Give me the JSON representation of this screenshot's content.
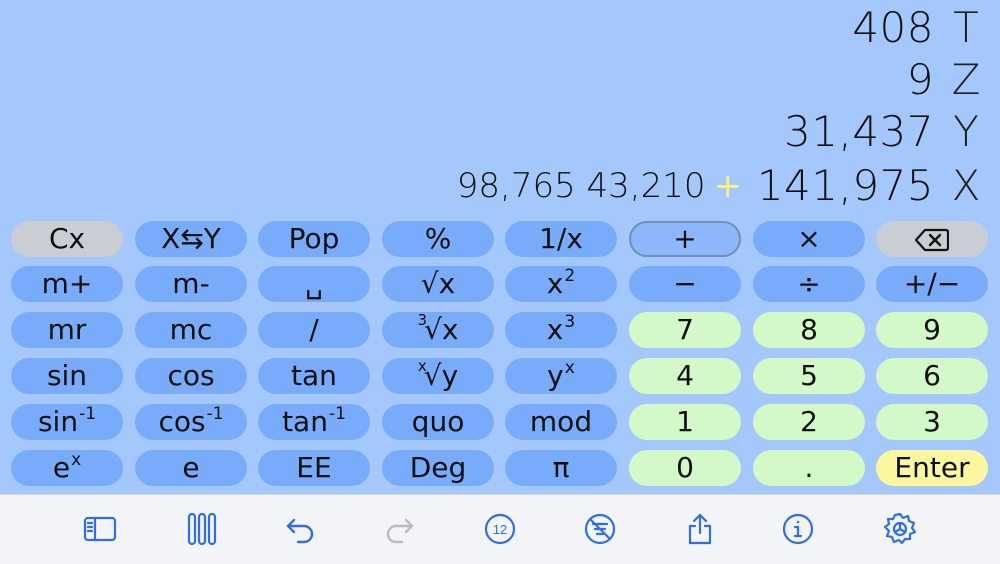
{
  "stack": {
    "t": {
      "value": "408",
      "label": "T"
    },
    "z": {
      "value": "9",
      "label": "Z"
    },
    "y": {
      "value": "31,437",
      "label": "Y"
    },
    "x": {
      "value": "141,975",
      "label": "X"
    }
  },
  "history": {
    "operand1": "98,765",
    "operand2": "43,210",
    "operator": "+"
  },
  "keys": {
    "cx": "Cx",
    "swap": "X⇆Y",
    "pop": "Pop",
    "percent": "%",
    "reciprocal": "1/x",
    "plus": "+",
    "times": "×",
    "mplus": "m+",
    "mminus": "m-",
    "space": "␣",
    "sqrt_base": "√x",
    "square_base": "x",
    "square_exp": "2",
    "minus": "−",
    "divide": "÷",
    "sign": "+∕−",
    "mr": "mr",
    "mc": "mc",
    "slash": "/",
    "cbrt_index": "3",
    "cbrt_base": "√x",
    "cube_base": "x",
    "cube_exp": "3",
    "seven": "7",
    "eight": "8",
    "nine": "9",
    "sin": "sin",
    "cos": "cos",
    "tan": "tan",
    "yroot_index": "x",
    "yroot_base": "√y",
    "pow_base": "y",
    "pow_exp": "x",
    "four": "4",
    "five": "5",
    "six": "6",
    "asin_base": "sin",
    "asin_exp": "-1",
    "acos_base": "cos",
    "acos_exp": "-1",
    "atan_base": "tan",
    "atan_exp": "-1",
    "quo": "quo",
    "mod": "mod",
    "one": "1",
    "two": "2",
    "three": "3",
    "exp_base": "e",
    "exp_exp": "x",
    "e": "e",
    "ee": "EE",
    "deg": "Deg",
    "pi": "π",
    "zero": "0",
    "dot": ".",
    "enter": "Enter"
  },
  "toolbar": {
    "icons": [
      "sidebar-icon",
      "columns-icon",
      "undo-icon",
      "redo-icon",
      "twelve-badge-icon",
      "no-filter-icon",
      "share-icon",
      "info-icon",
      "settings-gear-icon"
    ],
    "badge_text": "12"
  },
  "colors": {
    "background": "#a5c8fc",
    "key": "#78acfb",
    "digit_key": "#d4f9c9",
    "enter_key": "#fbf6a0",
    "clear_key": "#c9cdd4",
    "operator_highlight": "#f6f08a",
    "toolbar": "#f3f4f7",
    "toolbar_icon": "#2f6ee6"
  }
}
